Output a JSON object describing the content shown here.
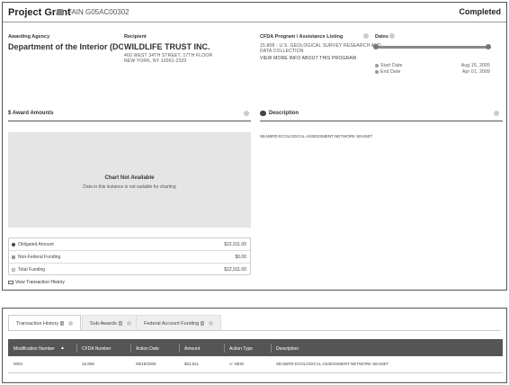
{
  "header": {
    "award_type": "Project Grant",
    "fain": "FAIN G05AC00302",
    "status": "Completed"
  },
  "awarding_agency": {
    "label": "Awarding Agency",
    "name": "Department of the Interior (DOI)"
  },
  "recipient": {
    "label": "Recipient",
    "name": "WILDLIFE TRUST INC.",
    "address_line1": "460 WEST 34TH STREET, 17TH FLOOR",
    "address_line2": "NEW YORK, NY 10001-2320"
  },
  "cfda": {
    "label": "CFDA Program / Assistance Listing",
    "text_line1": "15.808 - U.S. GEOLOGICAL SURVEY RESEARCH AND",
    "text_line2": "DATA COLLECTION",
    "link": "VIEW MORE INFO ABOUT THIS PROGRAM"
  },
  "dates": {
    "label": "Dates",
    "start_label": "Start Date",
    "start_value": "Aug 15, 2005",
    "end_label": "End Date",
    "end_value": "Apr 01, 2009",
    "progress_fraction": 1.0
  },
  "amounts": {
    "title": "$ Award Amounts",
    "chart_title": "Chart Not Available",
    "chart_subtitle": "Data in this instance is not suitable for charting",
    "rows": [
      {
        "label": "Obligated Amount",
        "value": "$22,911.00"
      },
      {
        "label": "Non-Federal Funding",
        "value": "$0.00"
      },
      {
        "label": "Total Funding",
        "value": "$22,911.00"
      }
    ],
    "history_link": "View Transaction History"
  },
  "description": {
    "title": "Description",
    "text": "SEABIRD ECOLOGICAL ASSESSMENT NETWORK SEANET"
  },
  "tabs": [
    {
      "label": "Transaction History",
      "count": "1"
    },
    {
      "label": "Sub-Awards",
      "count": "0"
    },
    {
      "label": "Federal Account Funding",
      "count": "0"
    }
  ],
  "table": {
    "headers": [
      "Modification Number",
      "CFDA Number",
      "Action Date",
      "Amount",
      "Action Type",
      "Description"
    ],
    "rows": [
      [
        "0004",
        "15.808",
        "08/15/2005",
        "$22,911",
        "A: New",
        "SEABIRD ECOLOGICAL ASSESSMENT NETWORK SEANET"
      ]
    ]
  }
}
